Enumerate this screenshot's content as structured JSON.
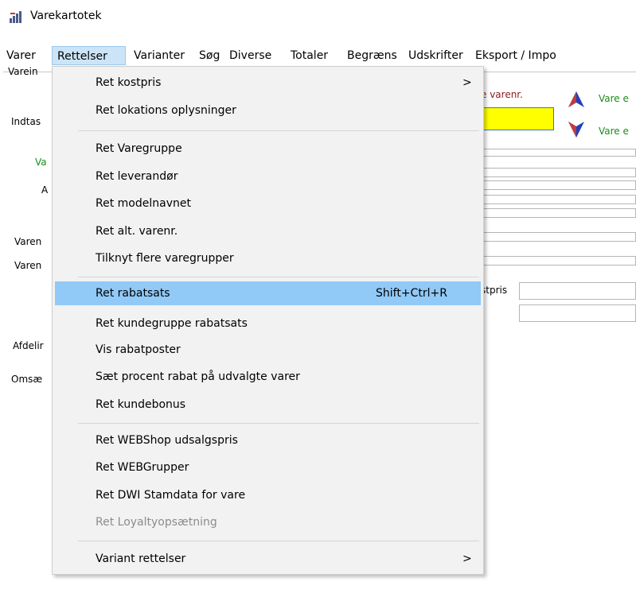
{
  "window": {
    "title": "Varekartotek",
    "icon": "bar-chart-app-icon"
  },
  "menubar": [
    {
      "label": "Varer"
    },
    {
      "label": "Rettelser"
    },
    {
      "label": "Varianter"
    },
    {
      "label": "Søg"
    },
    {
      "label": "Diverse"
    },
    {
      "label": "Totaler"
    },
    {
      "label": "Begræns"
    },
    {
      "label": "Udskrifter"
    },
    {
      "label": "Eksport / Impo"
    }
  ],
  "form": {
    "labels": {
      "varein": "Varein",
      "indtas": "Indtas",
      "va": "Va",
      "a": "A",
      "varen1": "Varen",
      "varen2": "Varen",
      "afdelir": "Afdelir",
      "omsae": "Omsæ",
      "varenr_suffix": "e varenr.",
      "kostpris": "stpris",
      "vare_up": "Vare e",
      "vare_down": "Vare e"
    }
  },
  "dropdown": {
    "items": [
      {
        "label": "Ret kostpris",
        "submenu": true
      },
      {
        "label": "Ret lokations oplysninger"
      },
      {
        "label": "Ret Varegruppe"
      },
      {
        "label": "Ret leverandør"
      },
      {
        "label": "Ret modelnavnet"
      },
      {
        "label": "Ret alt. varenr."
      },
      {
        "label": "Tilknyt flere varegrupper"
      },
      {
        "label": "Ret rabatsats",
        "shortcut": "Shift+Ctrl+R",
        "highlighted": true
      },
      {
        "label": "Ret kundegruppe rabatsats"
      },
      {
        "label": "Vis rabatposter"
      },
      {
        "label": "Sæt procent rabat på udvalgte varer"
      },
      {
        "label": "Ret kundebonus"
      },
      {
        "label": "Ret WEBShop udsalgspris"
      },
      {
        "label": "Ret WEBGrupper"
      },
      {
        "label": "Ret DWI Stamdata for vare"
      },
      {
        "label": "Ret Loyaltyopsætning",
        "disabled": true
      },
      {
        "label": "Variant rettelser",
        "submenu": true
      }
    ],
    "submenu_glyph": ">"
  },
  "colors": {
    "highlight": "#91c9f7",
    "menu_open": "#cce4f7",
    "yellow_field": "#ffff00",
    "arrow_up": "#1f3fbf",
    "arrow_down": "#1f3fbf"
  }
}
